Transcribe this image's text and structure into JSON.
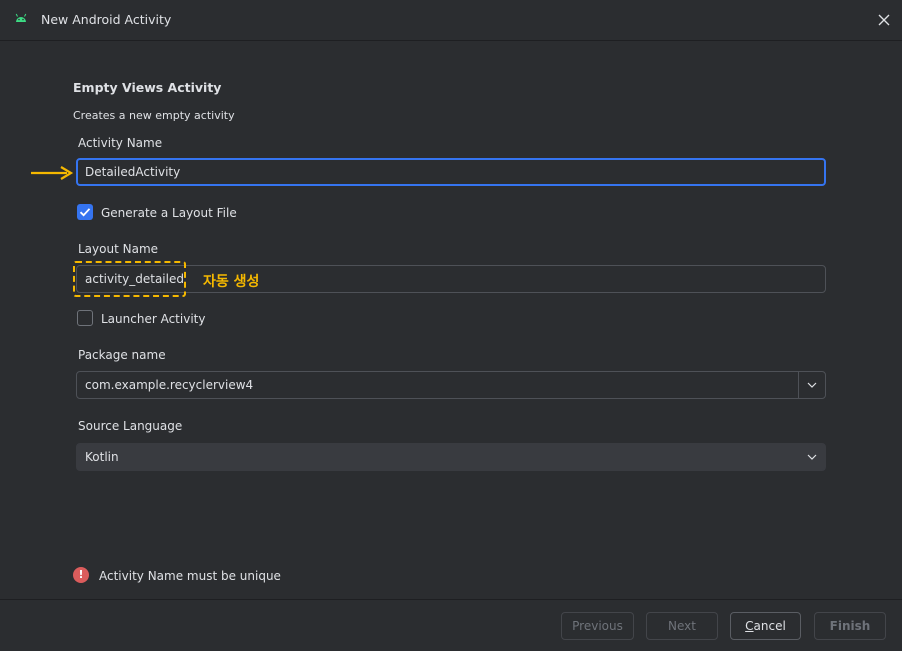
{
  "window": {
    "title": "New Android Activity",
    "app_icon": "android-icon",
    "close_icon": "close-icon"
  },
  "form": {
    "heading": "Empty Views Activity",
    "subheading": "Creates a new empty activity",
    "activity_name_label": "Activity Name",
    "activity_name_value": "DetailedActivity",
    "generate_layout_label": "Generate a Layout File",
    "generate_layout_checked": true,
    "layout_name_label": "Layout Name",
    "layout_name_value": "activity_detailed",
    "launcher_activity_label": "Launcher Activity",
    "launcher_activity_checked": false,
    "package_name_label": "Package name",
    "package_name_value": "com.example.recyclerview4",
    "source_language_label": "Source Language",
    "source_language_value": "Kotlin"
  },
  "annotations": {
    "auto_generated": "자동 생성",
    "color": "#f5b800"
  },
  "validation": {
    "error_icon": "!",
    "error_message": "Activity Name must be unique"
  },
  "footer": {
    "previous": "Previous",
    "next": "Next",
    "cancel_underlined": "C",
    "cancel_rest": "ancel",
    "finish": "Finish"
  },
  "colors": {
    "accent": "#3574f0",
    "error": "#db5c5c",
    "background": "#2b2d30"
  }
}
